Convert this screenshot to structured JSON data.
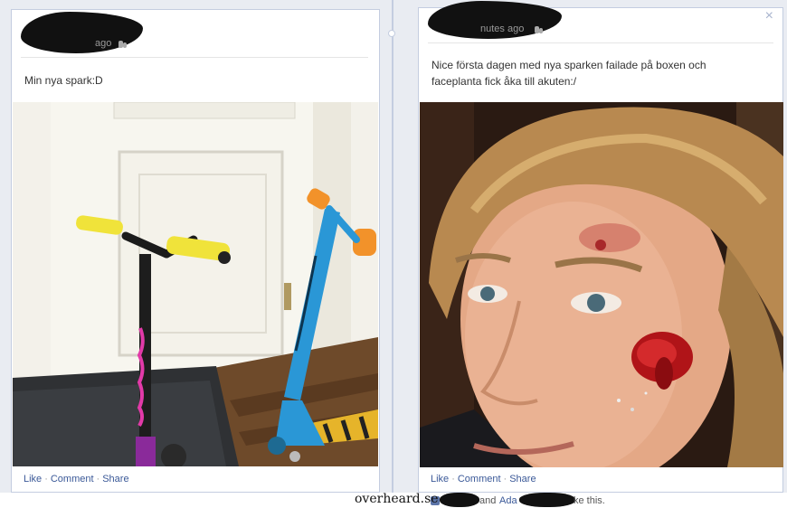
{
  "left_post": {
    "time_suffix": "ago",
    "message": "Min nya spark:D",
    "photo_alt": "scooter photo",
    "actions": {
      "like": "Like",
      "comment": "Comment",
      "share": "Share",
      "separator": "·"
    }
  },
  "right_post": {
    "time": "nutes ago",
    "message_line1": "Nice första dagen med nya sparken failade på boxen och",
    "message_line2": "faceplanta fick åka till akuten:/",
    "photo_alt": "injured face photo",
    "close": "×",
    "actions": {
      "like": "Like",
      "comment": "Comment",
      "share": "Share",
      "separator": "·"
    },
    "likes": {
      "and": "and",
      "name_partial": "Ada",
      "suffix": "ke this."
    }
  },
  "watermark": "overheard.se",
  "colors": {
    "link": "#3b5998",
    "border": "#c4cde0",
    "timeline": "#e9ecf2"
  }
}
